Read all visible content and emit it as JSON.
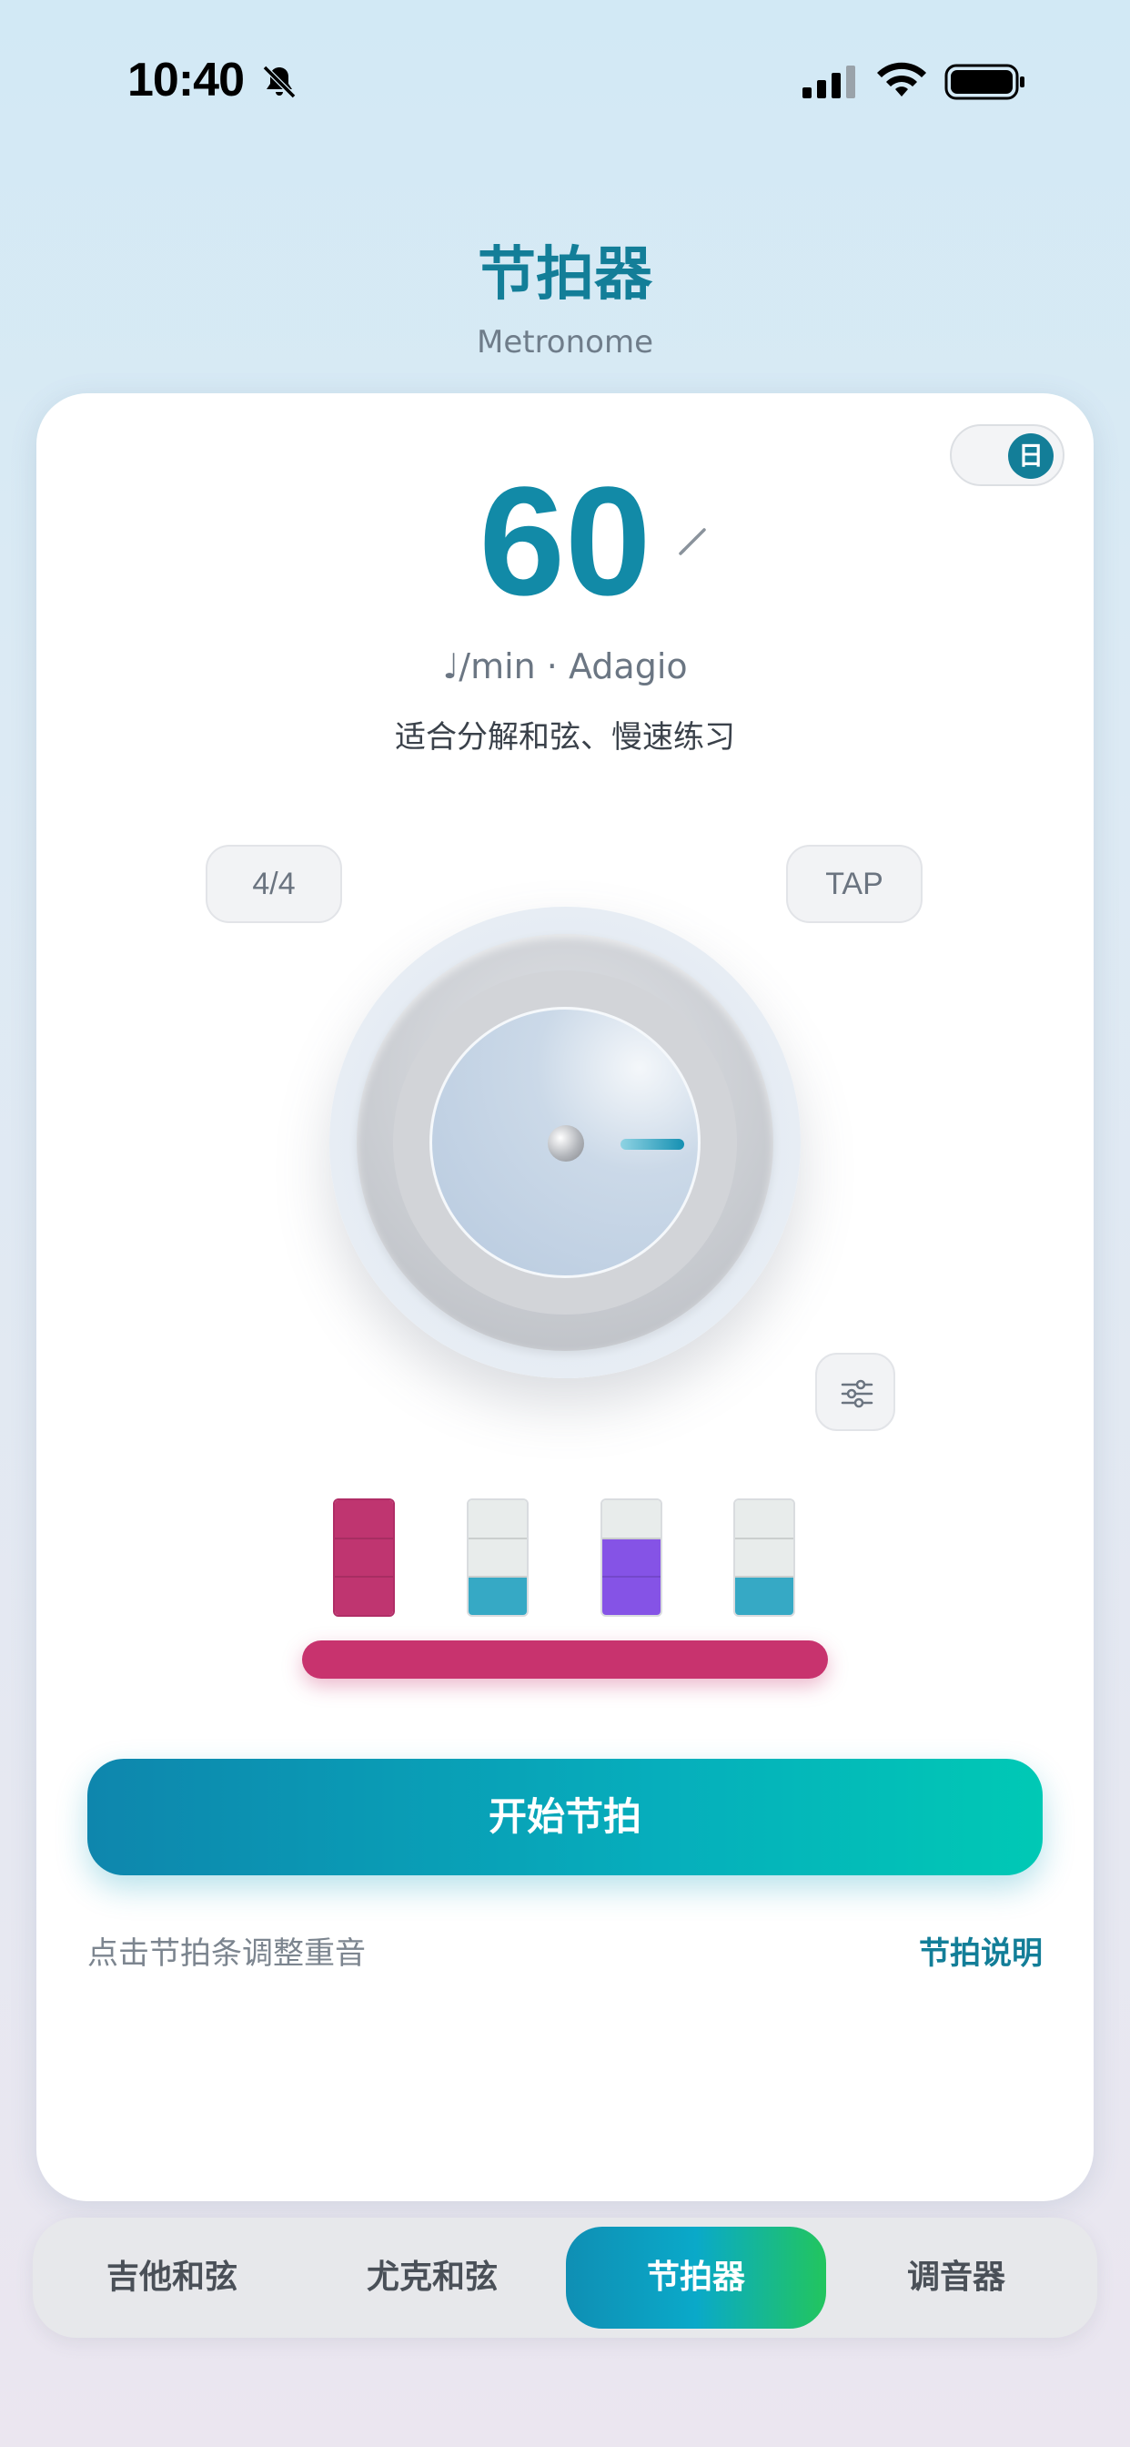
{
  "status_bar": {
    "time": "10:40",
    "icons": [
      "bell-slash-icon",
      "cellular-signal-icon",
      "wifi-icon",
      "battery-icon"
    ]
  },
  "header": {
    "title": "节拍器",
    "subtitle": "Metronome"
  },
  "theme_toggle": {
    "label": "日"
  },
  "tempo": {
    "bpm": "60",
    "unit_line": "♩/min · Adagio",
    "description": "适合分解和弦、慢速练习"
  },
  "controls": {
    "time_signature": "4/4",
    "tap_label": "TAP",
    "settings_icon": "sliders-icon"
  },
  "beats": [
    {
      "beat": 1,
      "segments": [
        "pink",
        "pink",
        "pink"
      ]
    },
    {
      "beat": 2,
      "segments": [
        "empty",
        "empty",
        "teal"
      ]
    },
    {
      "beat": 3,
      "segments": [
        "empty",
        "purple",
        "purple"
      ]
    },
    {
      "beat": 4,
      "segments": [
        "empty",
        "empty",
        "teal"
      ]
    }
  ],
  "colors": {
    "accent": "#137e98",
    "accent_beat": "#bf3570",
    "normal_beat": "#36a9c5",
    "medium_beat": "#8553e6"
  },
  "actions": {
    "start_label": "开始节拍",
    "hint": "点击节拍条调整重音",
    "info_link": "节拍说明"
  },
  "tabs": [
    {
      "label": "吉他和弦",
      "active": false
    },
    {
      "label": "尤克和弦",
      "active": false
    },
    {
      "label": "节拍器",
      "active": true
    },
    {
      "label": "调音器",
      "active": false
    }
  ]
}
